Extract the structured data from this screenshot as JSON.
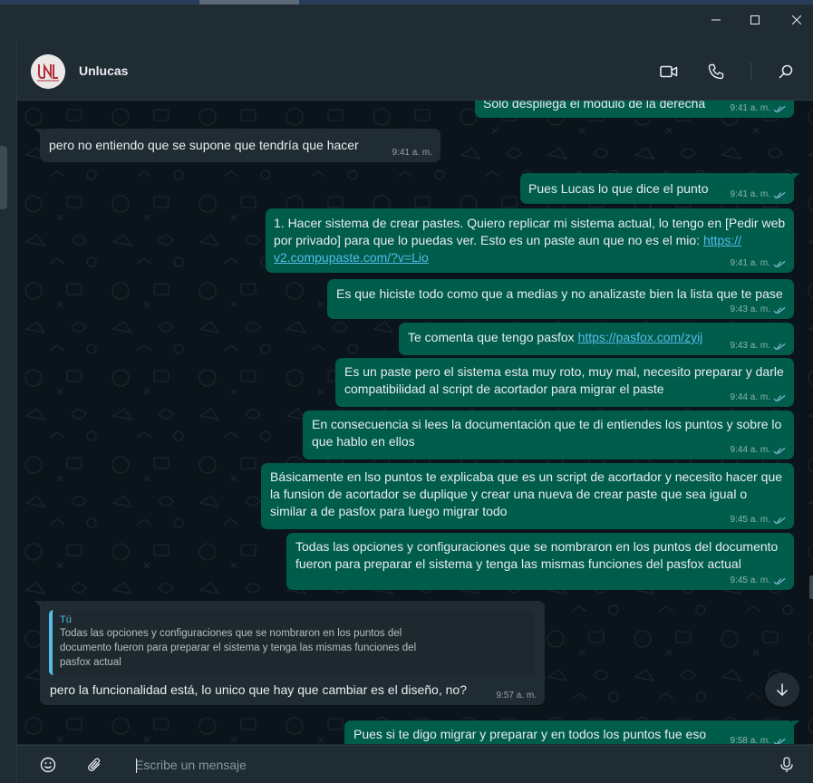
{
  "window": {
    "minimize_icon": "minimize-icon",
    "maximize_icon": "maximize-icon",
    "close_icon": "close-icon"
  },
  "header": {
    "contact_name": "Unlucas",
    "avatar_text": "UNL",
    "icons": [
      "video-call-icon",
      "voice-call-icon",
      "search-icon"
    ]
  },
  "messages": [
    {
      "dir": "out",
      "text": "Solo despliega el modulo de la derecha",
      "time": "9:41 a. m."
    },
    {
      "dir": "in",
      "text": "pero no entiendo que se supone que tendría que hacer",
      "time": "9:41 a. m."
    },
    {
      "dir": "out",
      "text": "Pues Lucas lo que dice el punto",
      "time": "9:41 a. m."
    },
    {
      "dir": "out",
      "text": "1. Hacer sistema de crear pastes. Quiero replicar mi sistema actual, lo tengo en [Pedir web por privado] para que lo puedas ver. Esto es un paste aun que no es el mio: ",
      "link": "https://v2.compupaste.com/?v=Lio",
      "link_l1": "https://",
      "link_l2": "v2.compupaste.com/?v=Lio",
      "time": "9:41 a. m."
    },
    {
      "dir": "out",
      "text": "Es que hiciste todo como que a medias y no analizaste bien la lista que te pase",
      "time": "9:43 a. m."
    },
    {
      "dir": "out",
      "text": "Te comenta que tengo pasfox ",
      "link": "https://pasfox.com/zyij",
      "time": "9:43 a. m."
    },
    {
      "dir": "out",
      "text": "Es un paste pero el sistema esta muy roto, muy mal, necesito preparar y darle compatibilidad al script de acortador para migrar el paste",
      "time": "9:44 a. m."
    },
    {
      "dir": "out",
      "text": "En consecuencia si lees la documentación que te di entiendes los puntos y sobre lo que hablo en ellos",
      "time": "9:44 a. m."
    },
    {
      "dir": "out",
      "text": "Básicamente en lso puntos te explicaba que es un script de acortador y necesito hacer que la funsion de acortador se duplique y crear una nueva de crear paste que sea igual o similar a de pasfox para luego migrar todo",
      "time": "9:45 a. m."
    },
    {
      "dir": "out",
      "text": "Todas las opciones y configuraciones que se nombraron en los puntos del documento fueron para preparar el sistema y tenga las mismas funciones del pasfox actual",
      "time": "9:45 a. m."
    },
    {
      "dir": "in",
      "quote_author": "Tú",
      "quote_text": "Todas las opciones y configuraciones que se nombraron en los puntos del documento fueron para preparar el sistema y tenga las mismas funciones del pasfox actual",
      "text": "pero la funcionalidad está, lo unico que hay que cambiar es el diseño, no?",
      "time": "9:57 a. m."
    },
    {
      "dir": "out",
      "text": "Pues si te digo migrar y preparar y en todos los puntos fue eso",
      "time": "9:58 a. m."
    }
  ],
  "composer": {
    "placeholder": "Escribe un mensaje",
    "icons": [
      "emoji-icon",
      "attach-icon",
      "microphone-icon"
    ]
  },
  "colors": {
    "outgoing_bubble": "#005c4b",
    "incoming_bubble": "#202c33",
    "chat_background": "#0b141a",
    "link": "#53bdeb",
    "read_ticks": "#8cc6e0"
  }
}
